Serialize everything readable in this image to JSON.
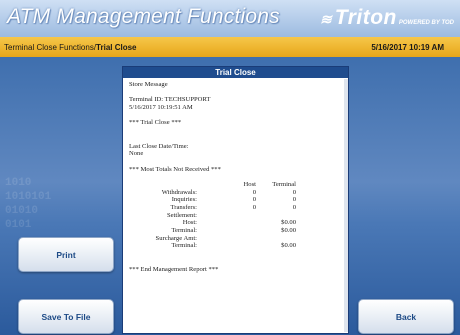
{
  "header": {
    "title": "ATM Management Functions",
    "brand": {
      "logo": "triton-swoosh-icon",
      "name": "Triton",
      "powered": "POWERED BY TOD"
    }
  },
  "subbar": {
    "breadcrumb_parent": "Terminal Close Functions/",
    "breadcrumb_current": "Trial Close",
    "datetime": "5/16/2017 10:19 AM"
  },
  "buttons": {
    "print": "Print",
    "save": "Save To File",
    "back": "Back"
  },
  "background": {
    "digits": [
      "1010",
      "1010101",
      "01010",
      "0101"
    ]
  },
  "report": {
    "title": "Trial Close",
    "store_message": "Store Message",
    "terminal_id": "Terminal ID: TECHSUPPORT",
    "timestamp": "5/16/2017 10:19:51 AM",
    "trial_close_banner": "*** Trial Close ***",
    "last_close_label": "Last Close Date/Time:",
    "last_close_value": "None",
    "most_totals": "*** Most Totals Not Received ***",
    "col_host": "Host",
    "col_terminal": "Terminal",
    "rows": [
      {
        "label": "Withdrawals:",
        "host": "0",
        "terminal": "0"
      },
      {
        "label": "Inquiries:",
        "host": "0",
        "terminal": "0"
      },
      {
        "label": "Transfers:",
        "host": "0",
        "terminal": "0"
      },
      {
        "label": "Settlement:",
        "host": "",
        "terminal": ""
      },
      {
        "label": "Host:",
        "host": "",
        "terminal": "$0.00"
      },
      {
        "label": "Terminal:",
        "host": "",
        "terminal": "$0.00"
      },
      {
        "label": "Surcharge Amt:",
        "host": "",
        "terminal": ""
      },
      {
        "label": "Terminal:",
        "host": "",
        "terminal": "$0.00"
      }
    ],
    "end_banner": "*** End Management Report ***"
  },
  "colors": {
    "header_blue": "#9cbbe0",
    "subbar_gold": "#f3b52e",
    "panel_title": "#1f4c8e"
  }
}
